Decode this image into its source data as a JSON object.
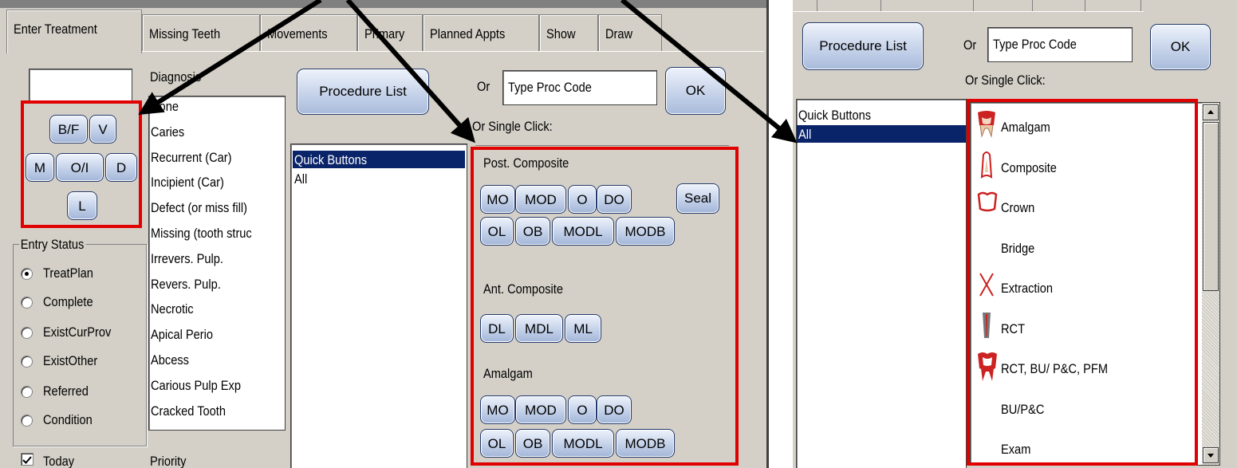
{
  "left": {
    "tabs": [
      "Enter Treatment",
      "Missing Teeth",
      "Movements",
      "Primary",
      "Planned Appts",
      "Show",
      "Draw"
    ],
    "surface_buttons": {
      "bf": "B/F",
      "v": "V",
      "m": "M",
      "oi": "O/I",
      "d": "D",
      "l": "L"
    },
    "diagnosis": {
      "label": "Diagnosis",
      "items": [
        "None",
        "Caries",
        "Recurrent (Car)",
        "Incipient (Car)",
        "Defect (or miss fill)",
        "Missing (tooth struc",
        "Irrevers. Pulp.",
        "Revers. Pulp.",
        "Necrotic",
        "Apical Perio",
        "Abcess",
        "Carious Pulp Exp",
        "Cracked Tooth"
      ]
    },
    "entry_status": {
      "label": "Entry Status",
      "options": [
        "TreatPlan",
        "Complete",
        "ExistCurProv",
        "ExistOther",
        "Referred",
        "Condition"
      ],
      "selected": "TreatPlan"
    },
    "today_label": "Today",
    "priority_label": "Priority",
    "procedure_list_label": "Procedure List",
    "or_label": "Or",
    "proc_code_value": "Type Proc Code",
    "ok_label": "OK",
    "single_click_label": "Or Single Click:",
    "categories": [
      "Quick Buttons",
      "All"
    ],
    "selected_category": "Quick Buttons",
    "quick": {
      "post_composite": {
        "heading": "Post. Composite",
        "row1": [
          "MO",
          "MOD",
          "O",
          "DO"
        ],
        "seal": "Seal",
        "row2": [
          "OL",
          "OB",
          "MODL",
          "MODB"
        ]
      },
      "ant_composite": {
        "heading": "Ant. Composite",
        "row1": [
          "DL",
          "MDL",
          "ML"
        ]
      },
      "amalgam": {
        "heading": "Amalgam",
        "row1": [
          "MO",
          "MOD",
          "O",
          "DO"
        ],
        "row2": [
          "OL",
          "OB",
          "MODL",
          "MODB"
        ]
      }
    }
  },
  "right": {
    "procedure_list_label": "Procedure List",
    "or_label": "Or",
    "proc_code_value": "Type Proc Code",
    "ok_label": "OK",
    "single_click_label": "Or Single Click:",
    "categories": [
      "Quick Buttons",
      "All"
    ],
    "selected_category": "All",
    "procedures": [
      "Amalgam",
      "Composite",
      "Crown",
      "Bridge",
      "Extraction",
      "RCT",
      "RCT, BU/ P&C, PFM",
      "BU/P&C",
      "Exam"
    ]
  },
  "colors": {
    "highlight_red": "#e00000",
    "selection_blue": "#0a246a",
    "panel_gray": "#d4d0c8"
  }
}
